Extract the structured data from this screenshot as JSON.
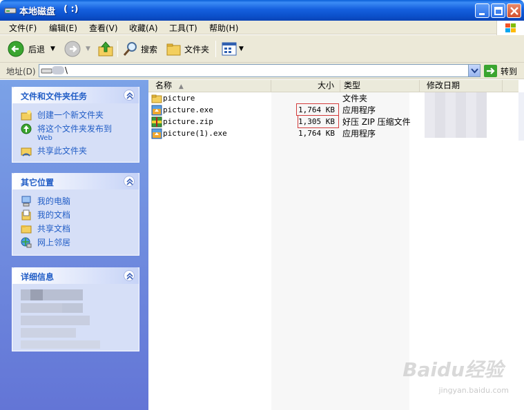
{
  "window": {
    "title": "本地磁盘",
    "title_suffix": "(  :)"
  },
  "menu": [
    "文件(F)",
    "编辑(E)",
    "查看(V)",
    "收藏(A)",
    "工具(T)",
    "帮助(H)"
  ],
  "toolbar": {
    "back": "后退",
    "search": "搜索",
    "folders": "文件夹"
  },
  "address": {
    "label": "地址(D)",
    "value": "\\",
    "go": "转到"
  },
  "left": {
    "tasks": {
      "title": "文件和文件夹任务",
      "items": [
        {
          "label": "创建一个新文件夹"
        },
        {
          "label": "将这个文件夹发布到",
          "sub": "Web"
        },
        {
          "label": "共享此文件夹"
        }
      ]
    },
    "places": {
      "title": "其它位置",
      "items": [
        {
          "label": "我的电脑"
        },
        {
          "label": "我的文档"
        },
        {
          "label": "共享文档"
        },
        {
          "label": "网上邻居"
        }
      ]
    },
    "details": {
      "title": "详细信息"
    }
  },
  "columns": {
    "name": "名称",
    "size": "大小",
    "type": "类型",
    "date": "修改日期"
  },
  "files": [
    {
      "name": "picture",
      "size": "",
      "type": "文件夹",
      "icon": "folder-icon"
    },
    {
      "name": "picture.exe",
      "size": "1,764 KB",
      "type": "应用程序",
      "icon": "exe-icon"
    },
    {
      "name": "picture.zip",
      "size": "1,305 KB",
      "type": "好压 ZIP 压缩文件",
      "icon": "zip-icon"
    },
    {
      "name": "picture(1).exe",
      "size": "1,764 KB",
      "type": "应用程序",
      "icon": "exe-icon"
    }
  ],
  "watermark": {
    "brand": "Baidu经验",
    "url": "jingyan.baidu.com"
  },
  "colors": {
    "titlebar": "#0b4fc9",
    "panel_title": "#215dc6",
    "highlight": "#d23a3a"
  }
}
